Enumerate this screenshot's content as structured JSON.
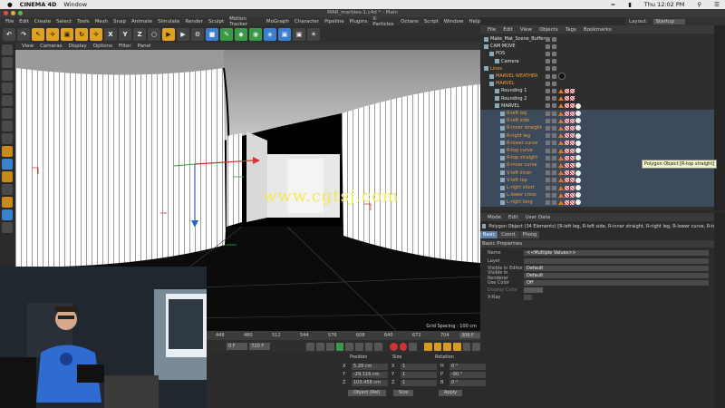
{
  "mac_menu": {
    "app": "CINEMA 4D",
    "window": "Window",
    "clock": "Thu 12:02 PM"
  },
  "window_title": "MAR_marbles-1.c4d * - Main",
  "menu": [
    "File",
    "Edit",
    "Create",
    "Select",
    "Tools",
    "Mesh",
    "Snap",
    "Animate",
    "Simulate",
    "Render",
    "Sculpt",
    "Motion Tracker",
    "MoGraph",
    "Character",
    "Pipeline",
    "Plugins",
    "X-Particles",
    "Octane",
    "Script",
    "Window",
    "Help"
  ],
  "layout": {
    "label": "Layout:",
    "value": "Startup"
  },
  "toolbar": {
    "x": "X",
    "y": "Y",
    "z": "Z"
  },
  "viewport": {
    "menu": [
      "View",
      "Cameras",
      "Display",
      "Options",
      "Filter",
      "Panel"
    ],
    "grid_spacing": "Grid Spacing : 100 cm",
    "watermark": "www.cgtsj.com"
  },
  "timeline": {
    "ticks": [
      "448",
      "480",
      "512",
      "544",
      "576",
      "608",
      "640",
      "672",
      "704"
    ],
    "end": "306 F"
  },
  "transport": {
    "start": "0 F",
    "end": "720 F"
  },
  "coords": {
    "headers": [
      "Position",
      "Size",
      "Rotation"
    ],
    "rows": [
      {
        "axis": "X",
        "pos": "5.28 cm",
        "size_axis": "X",
        "size": "1",
        "rot_axis": "H",
        "rot": "0 °"
      },
      {
        "axis": "Y",
        "pos": "-29.116 cm",
        "size_axis": "Y",
        "size": "1",
        "rot_axis": "P",
        "rot": "-90 °"
      },
      {
        "axis": "Z",
        "pos": "103.458 cm",
        "size_axis": "Z",
        "size": "1",
        "rot_axis": "B",
        "rot": "0 °"
      }
    ],
    "object": "Object (Rel)",
    "size_mode": "Size",
    "apply": "Apply"
  },
  "object_manager": {
    "menu": [
      "File",
      "Edit",
      "View",
      "Objects",
      "Tags",
      "Bookmarks"
    ],
    "rows": [
      {
        "name": "Make_Mat_Scene_Buffers",
        "depth": 0,
        "color": "white",
        "tags": ""
      },
      {
        "name": "CAM MOVE",
        "depth": 0,
        "color": "white",
        "tags": ""
      },
      {
        "name": "POS",
        "depth": 1,
        "color": "white",
        "tags": ""
      },
      {
        "name": "Camera",
        "depth": 2,
        "color": "white",
        "tags": ""
      },
      {
        "name": "Lines",
        "depth": 0,
        "color": "orange",
        "tags": ""
      },
      {
        "name": "MARVEL WEATHER",
        "depth": 1,
        "color": "orange",
        "tags": "black"
      },
      {
        "name": "MARVEL",
        "depth": 1,
        "color": "orange",
        "tags": ""
      },
      {
        "name": "Rounding 1",
        "depth": 2,
        "color": "white",
        "tags": "tri"
      },
      {
        "name": "Rounding 2",
        "depth": 2,
        "color": "white",
        "tags": "tri"
      },
      {
        "name": "MARVEL",
        "depth": 2,
        "color": "white",
        "tags": "full"
      },
      {
        "name": "R-left leg",
        "depth": 3,
        "color": "orange",
        "tags": "full"
      },
      {
        "name": "R-left side",
        "depth": 3,
        "color": "orange",
        "tags": "full"
      },
      {
        "name": "R-inner straight",
        "depth": 3,
        "color": "orange",
        "tags": "full"
      },
      {
        "name": "R-right leg",
        "depth": 3,
        "color": "orange",
        "tags": "full"
      },
      {
        "name": "R-lower curve",
        "depth": 3,
        "color": "orange",
        "tags": "full"
      },
      {
        "name": "R-top curve",
        "depth": 3,
        "color": "orange",
        "tags": "full"
      },
      {
        "name": "R-top straight",
        "depth": 3,
        "color": "orange",
        "tags": "full"
      },
      {
        "name": "R-inner curve",
        "depth": 3,
        "color": "orange",
        "tags": "full"
      },
      {
        "name": "V-left inner",
        "depth": 3,
        "color": "orange",
        "tags": "full"
      },
      {
        "name": "V-left top",
        "depth": 3,
        "color": "orange",
        "tags": "full"
      },
      {
        "name": "L-right short",
        "depth": 3,
        "color": "orange",
        "tags": "full"
      },
      {
        "name": "L-lower cross",
        "depth": 3,
        "color": "orange",
        "tags": "full"
      },
      {
        "name": "L-right long",
        "depth": 3,
        "color": "orange",
        "tags": "full"
      }
    ],
    "tooltip": "Polygon Object [R-top straight]"
  },
  "attributes": {
    "menu": [
      "Mode",
      "Edit",
      "User Data"
    ],
    "title": "Polygon Object (34 Elements) [R-left leg, R-left side, R-inner straight, R-right leg, R-lower curve, R-top straight, R-",
    "tabs": [
      "Basic",
      "Coord.",
      "Phong"
    ],
    "section": "Basic Properties",
    "rows": [
      {
        "key": "Name",
        "value": "<<Multiple Values>>"
      },
      {
        "key": "Layer",
        "value": ""
      },
      {
        "key": "Visible in Editor",
        "value": "Default"
      },
      {
        "key": "Visible in Renderer",
        "value": "Default"
      },
      {
        "key": "Use Color",
        "value": "Off"
      },
      {
        "key": "Display Color",
        "value": ""
      },
      {
        "key": "X-Ray",
        "value": ""
      }
    ]
  },
  "colors": {
    "accent_orange": "#f0a030",
    "selection": "#3d4a5c",
    "panel": "#2e2e2e"
  }
}
